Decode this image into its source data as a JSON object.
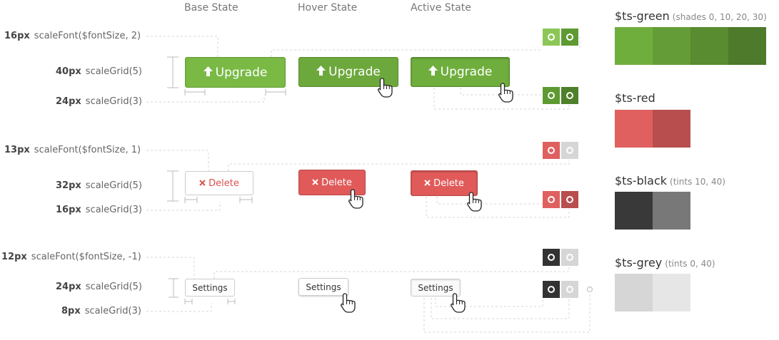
{
  "columns": [
    "Base State",
    "Hover State",
    "Active State"
  ],
  "specs": [
    {
      "px": "16px",
      "fn": "scaleFont($fontSize, 2)"
    },
    {
      "px": "40px",
      "fn": "scaleGrid(5)"
    },
    {
      "px": "24px",
      "fn": "scaleGrid(3)"
    },
    {
      "px": "13px",
      "fn": "scaleFont($fontSize, 1)"
    },
    {
      "px": "32px",
      "fn": "scaleGrid(5)"
    },
    {
      "px": "16px",
      "fn": "scaleGrid(3)"
    },
    {
      "px": "12px",
      "fn": "scaleFont($fontSize, -1)"
    },
    {
      "px": "24px",
      "fn": "scaleGrid(5)"
    },
    {
      "px": "8px",
      "fn": "scaleGrid(3)"
    }
  ],
  "buttons": {
    "upgrade": "Upgrade",
    "delete": "Delete",
    "settings": "Settings"
  },
  "icons": {
    "upgrade": "arrow-up-icon",
    "delete": "x-icon",
    "cursor": "hand-pointer-icon"
  },
  "palettes": [
    {
      "name": "$ts-green",
      "note": "(shades 0, 10, 20, 30)",
      "colors": [
        "#6fae3d",
        "#649d37",
        "#598b31",
        "#4e7a2b"
      ]
    },
    {
      "name": "$ts-red",
      "note": "",
      "colors": [
        "#e06060",
        "#b84e4e"
      ]
    },
    {
      "name": "$ts-black",
      "note": "(tints 10, 40)",
      "colors": [
        "#393939",
        "#787878"
      ]
    },
    {
      "name": "$ts-grey",
      "note": "(tints 0, 40)",
      "colors": [
        "#d6d6d6",
        "#e6e6e6"
      ]
    }
  ],
  "swatch_colors": {
    "green_light": "#8cc657",
    "green": "#5e9a32",
    "green_dark": "#4e7f2a",
    "red": "#e06060",
    "red_dark": "#b84e4e",
    "grey_light": "#d6d6d6",
    "black": "#333333"
  }
}
